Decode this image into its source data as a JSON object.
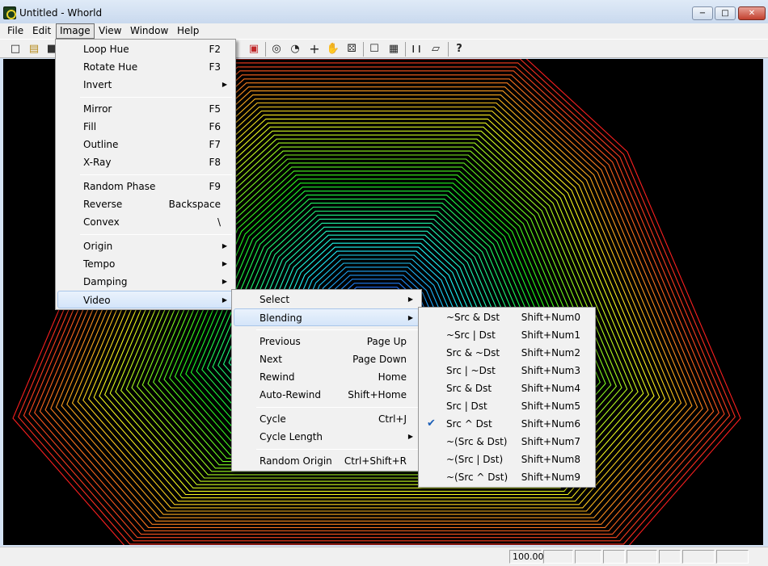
{
  "window": {
    "title": "Untitled - Whorld",
    "minimize": "−",
    "maximize": "□",
    "close": "✕"
  },
  "menubar": {
    "file": "File",
    "edit": "Edit",
    "image": "Image",
    "view": "View",
    "window": "Window",
    "help": "Help"
  },
  "toolbar": {
    "new_icon": "□",
    "open_icon": "▤",
    "save_icon": "■",
    "color_icon": "▣",
    "origin_icon": "◎",
    "spin_icon": "◔",
    "crosshair_icon": "+",
    "hand_icon": "✋",
    "dice_icon": "⚄",
    "snapshot_icon": "☐",
    "export_icon": "▦",
    "pause_icon": "❙❙",
    "eraser_icon": "▱",
    "help_icon": "?"
  },
  "image_menu": {
    "loop_hue": "Loop Hue",
    "loop_hue_key": "F2",
    "rotate_hue": "Rotate Hue",
    "rotate_hue_key": "F3",
    "invert": "Invert",
    "mirror": "Mirror",
    "mirror_key": "F5",
    "fill": "Fill",
    "fill_key": "F6",
    "outline": "Outline",
    "outline_key": "F7",
    "xray": "X-Ray",
    "xray_key": "F8",
    "random_phase": "Random Phase",
    "random_phase_key": "F9",
    "reverse": "Reverse",
    "reverse_key": "Backspace",
    "convex": "Convex",
    "convex_key": "\\",
    "origin": "Origin",
    "tempo": "Tempo",
    "damping": "Damping",
    "video": "Video"
  },
  "video_menu": {
    "select": "Select",
    "blending": "Blending",
    "previous": "Previous",
    "previous_key": "Page Up",
    "next": "Next",
    "next_key": "Page Down",
    "rewind": "Rewind",
    "rewind_key": "Home",
    "auto_rewind": "Auto-Rewind",
    "auto_rewind_key": "Shift+Home",
    "cycle": "Cycle",
    "cycle_key": "Ctrl+J",
    "cycle_length": "Cycle Length",
    "random_origin": "Random Origin",
    "random_origin_key": "Ctrl+Shift+R"
  },
  "blending_menu": [
    {
      "label": "~Src & Dst",
      "key": "Shift+Num0",
      "checked": false
    },
    {
      "label": "~Src | Dst",
      "key": "Shift+Num1",
      "checked": false
    },
    {
      "label": "Src & ~Dst",
      "key": "Shift+Num2",
      "checked": false
    },
    {
      "label": "Src | ~Dst",
      "key": "Shift+Num3",
      "checked": false
    },
    {
      "label": "Src & Dst",
      "key": "Shift+Num4",
      "checked": false
    },
    {
      "label": "Src | Dst",
      "key": "Shift+Num5",
      "checked": false
    },
    {
      "label": "Src ^ Dst",
      "key": "Shift+Num6",
      "checked": true
    },
    {
      "label": "~(Src & Dst)",
      "key": "Shift+Num7",
      "checked": false
    },
    {
      "label": "~(Src | Dst)",
      "key": "Shift+Num8",
      "checked": false
    },
    {
      "label": "~(Src ^ Dst)",
      "key": "Shift+Num9",
      "checked": false
    }
  ],
  "blending_check": "✔",
  "submenu_arrow": "▶",
  "statusbar": {
    "zoom": "100.00"
  },
  "colors": {
    "canvas": "#000000",
    "menu_bg": "#f1f1f1",
    "highlight": "#d4e5f9",
    "check": "#1c5fb7"
  }
}
